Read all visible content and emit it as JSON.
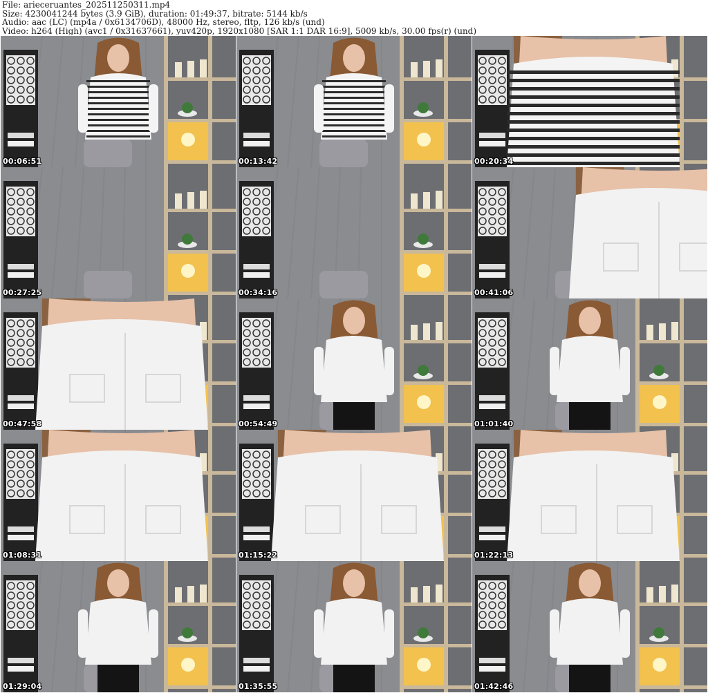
{
  "header": {
    "file_line": "File: arieceruantes_202511250311.mp4",
    "size_line": "Size: 4230041244 bytes (3.9 GiB), duration: 01:49:37, bitrate: 5144 kb/s",
    "audio_line": "Audio: aac (LC) (mp4a / 0x6134706D), 48000 Hz, stereo, fltp, 126 kb/s (und)",
    "video_line": "Video: h264 (High) (avc1 / 0x31637661), yuv420p, 1920x1080 [SAR 1:1 DAR 16:9], 5009 kb/s, 30.00 fps(r) (und)"
  },
  "thumbnails": [
    {
      "timestamp": "00:06:51",
      "scene": "wide",
      "top": "stripes"
    },
    {
      "timestamp": "00:13:42",
      "scene": "wide",
      "top": "stripes"
    },
    {
      "timestamp": "00:20:34",
      "scene": "close",
      "top": "stripes"
    },
    {
      "timestamp": "00:27:25",
      "scene": "empty",
      "top": "none"
    },
    {
      "timestamp": "00:34:16",
      "scene": "empty",
      "top": "none"
    },
    {
      "timestamp": "00:41:06",
      "scene": "close-side",
      "top": "white"
    },
    {
      "timestamp": "00:47:58",
      "scene": "close",
      "top": "white"
    },
    {
      "timestamp": "00:54:49",
      "scene": "wide",
      "top": "white"
    },
    {
      "timestamp": "01:01:40",
      "scene": "wide",
      "top": "white"
    },
    {
      "timestamp": "01:08:31",
      "scene": "close",
      "top": "white"
    },
    {
      "timestamp": "01:15:22",
      "scene": "close",
      "top": "white"
    },
    {
      "timestamp": "01:22:13",
      "scene": "close",
      "top": "white"
    },
    {
      "timestamp": "01:29:04",
      "scene": "wide",
      "top": "white"
    },
    {
      "timestamp": "01:35:55",
      "scene": "wide",
      "top": "white"
    },
    {
      "timestamp": "01:42:46",
      "scene": "wide",
      "top": "white"
    }
  ],
  "colors": {
    "wall": "#8a8c90",
    "shelf": "#c9b89a",
    "lamp_glow": "#f2c14e",
    "lamp_frame": "#222222",
    "white_top": "#f2f2f2",
    "stripe_dark": "#2a2a2a",
    "hair": "#8a5a34",
    "skin": "#e7c1a8",
    "skirt": "#141414",
    "chair": "#9a9aa0"
  }
}
